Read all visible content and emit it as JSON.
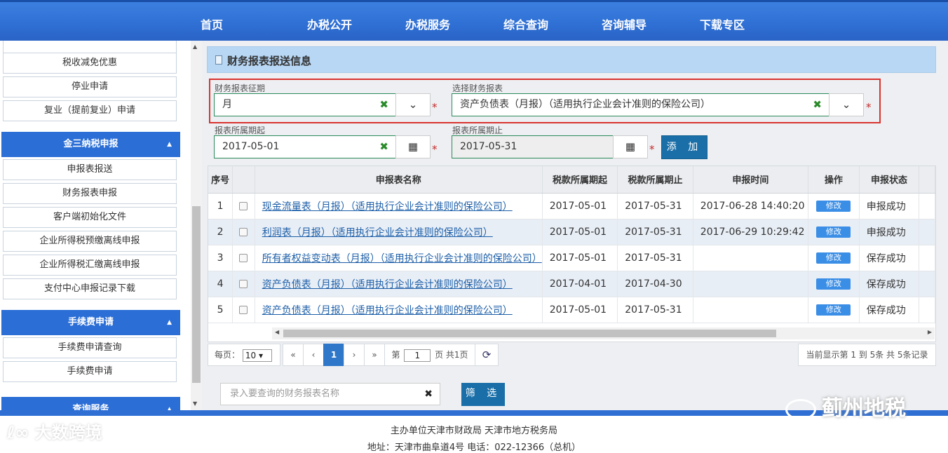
{
  "nav": [
    "首页",
    "办税公开",
    "办税服务",
    "综合查询",
    "咨询辅导",
    "下载专区"
  ],
  "sidebar": {
    "group1_items": [
      "税收减免优惠",
      "停业申请",
      "复业（提前复业）申请"
    ],
    "group2_title": "金三纳税申报",
    "group2_items": [
      "申报表报送",
      "财务报表申报",
      "客户端初始化文件",
      "企业所得税预缴离线申报",
      "企业所得税汇缴离线申报",
      "支付中心申报记录下载"
    ],
    "group3_title": "手续费申请",
    "group3_items": [
      "手续费申请查询",
      "手续费申请"
    ],
    "group4_title": "查询服务"
  },
  "panel": {
    "title": "财务报表报送信息"
  },
  "form": {
    "period_label": "财务报表征期",
    "period_value": "月",
    "report_label": "选择财务报表",
    "report_value": "资产负债表（月报）（适用执行企业会计准则的保险公司）",
    "start_label": "报表所属期起",
    "start_value": "2017-05-01",
    "end_label": "报表所属期止",
    "end_value": "2017-05-31",
    "add_label": "添 加",
    "required": "*"
  },
  "table": {
    "headers": [
      "序号",
      "",
      "申报表名称",
      "税款所属期起",
      "税款所属期止",
      "申报时间",
      "操作",
      "申报状态"
    ],
    "edit_label": "修改",
    "rows": [
      {
        "no": "1",
        "name": "现金流量表（月报）（适用执行企业会计准则的保险公司）",
        "start": "2017-05-01",
        "end": "2017-05-31",
        "time": "2017-06-28 14:40:20",
        "status": "申报成功"
      },
      {
        "no": "2",
        "name": "利润表（月报）（适用执行企业会计准则的保险公司）",
        "start": "2017-05-01",
        "end": "2017-05-31",
        "time": "2017-06-29 10:29:42",
        "status": "申报成功"
      },
      {
        "no": "3",
        "name": "所有者权益变动表（月报）（适用执行企业会计准则的保险公司）",
        "start": "2017-05-01",
        "end": "2017-05-31",
        "time": "",
        "status": "保存成功"
      },
      {
        "no": "4",
        "name": "资产负债表（月报）（适用执行企业会计准则的保险公司）",
        "start": "2017-04-01",
        "end": "2017-04-30",
        "time": "",
        "status": "保存成功"
      },
      {
        "no": "5",
        "name": "资产负债表（月报）（适用执行企业会计准则的保险公司）",
        "start": "2017-05-01",
        "end": "2017-05-31",
        "time": "",
        "status": "保存成功"
      }
    ]
  },
  "pager": {
    "per_page_label": "每页：",
    "per_page_value": "10",
    "first": "«",
    "prev": "‹",
    "current": "1",
    "next": "›",
    "last": "»",
    "page_prefix": "第",
    "page_input": "1",
    "page_suffix": "页 共1页",
    "info": "当前显示第 1 到 5条  共 5条记录"
  },
  "search": {
    "placeholder": "录入要查询的财务报表名称",
    "button": "筛 选"
  },
  "footer": {
    "line1": "主办单位天津市财政局 天津市地方税务局",
    "line2": "地址：天津市曲阜道4号 电话：022-12366（总机）"
  },
  "watermarks": {
    "left": "大数跨境",
    "right": "蓟州地税"
  }
}
